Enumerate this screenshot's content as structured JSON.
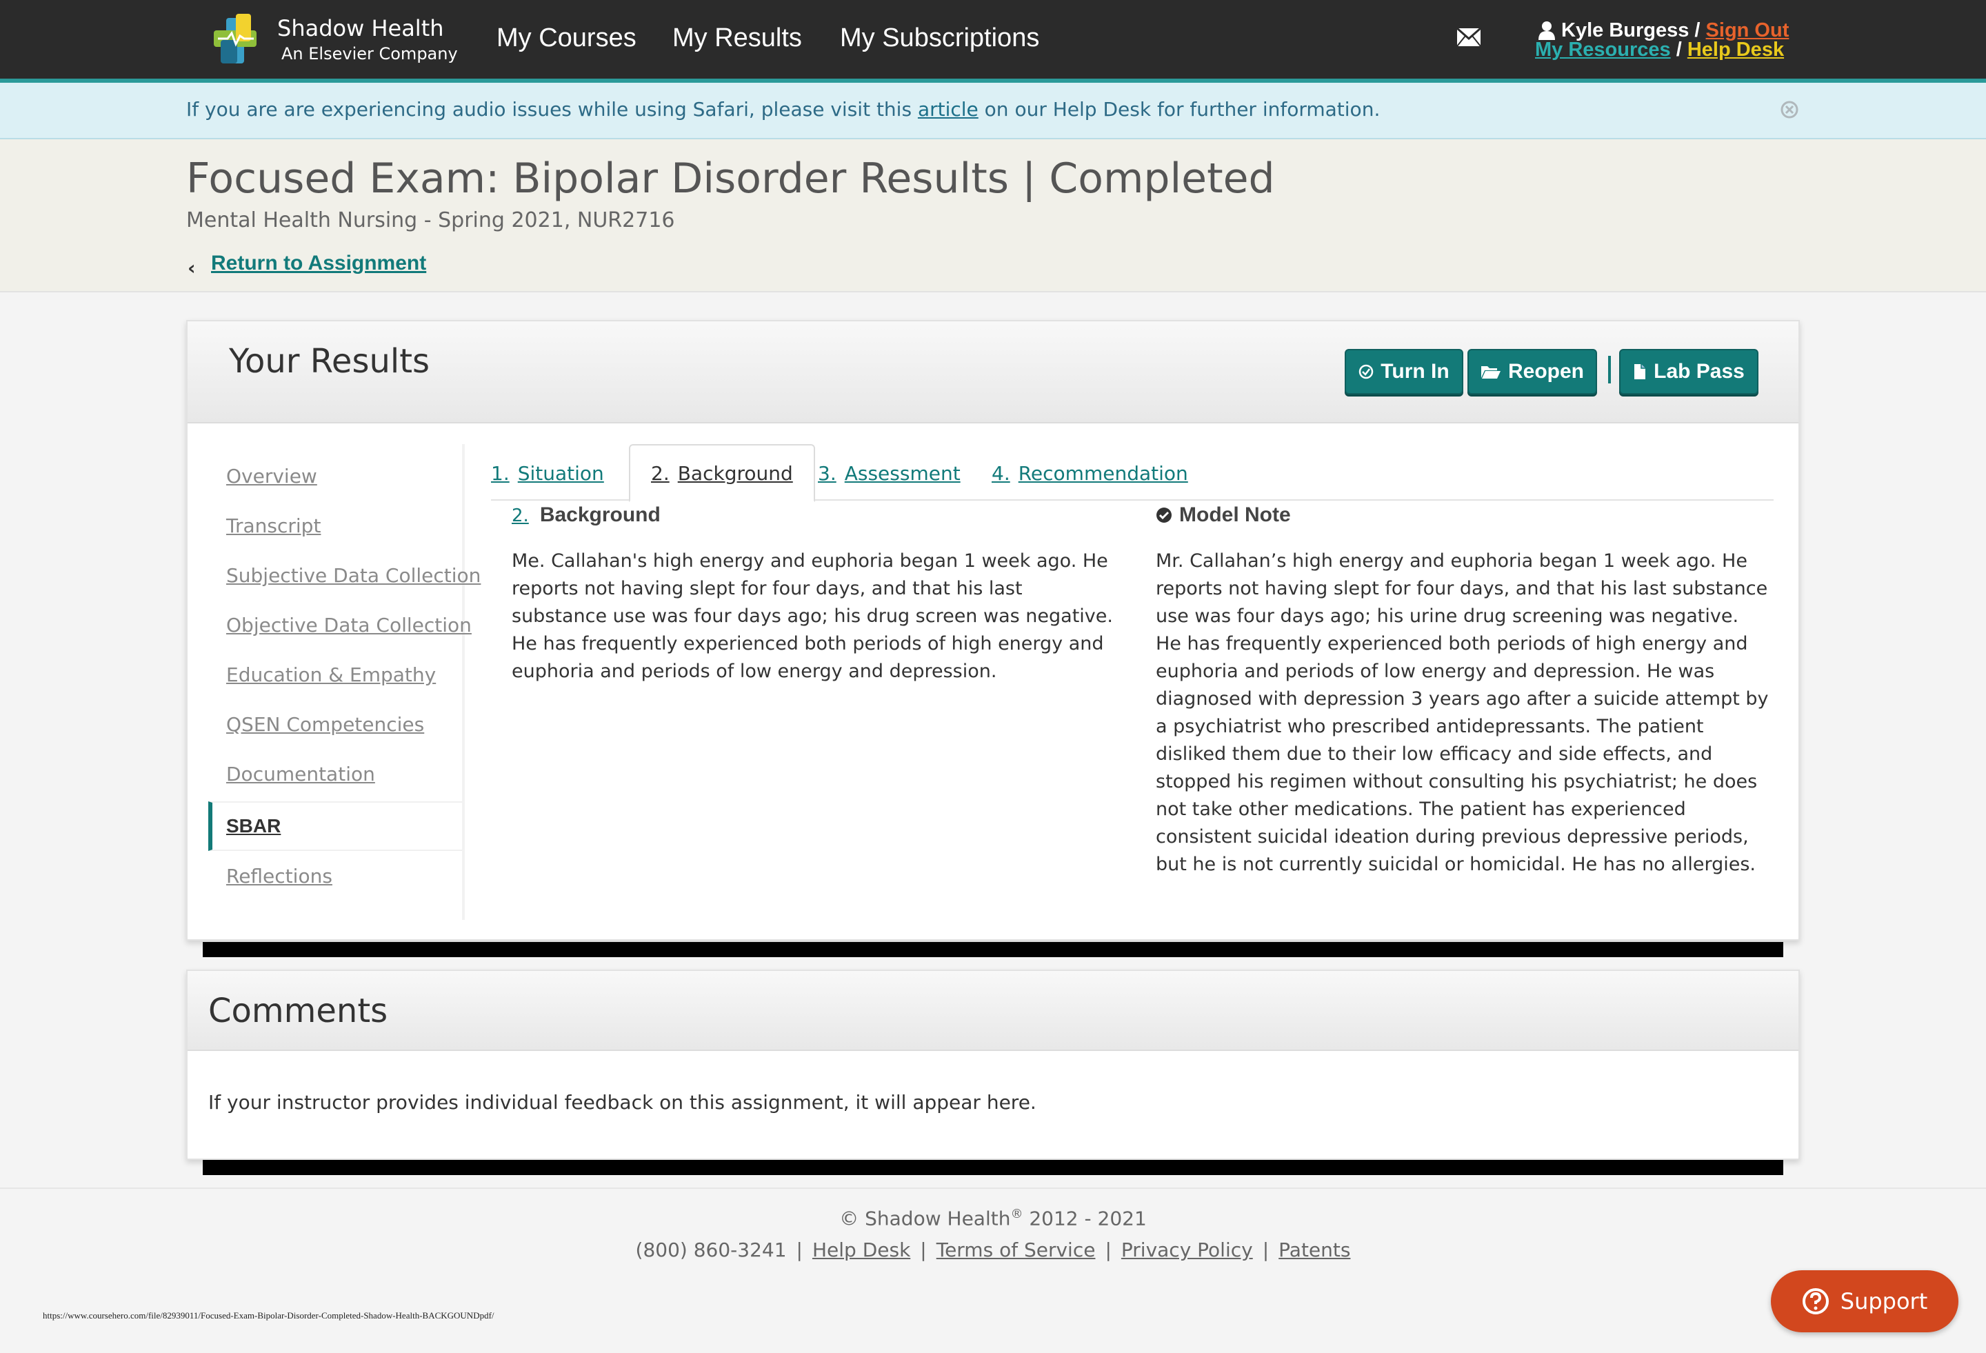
{
  "brand": {
    "name": "Shadow Health",
    "tagline": "An Elsevier Company"
  },
  "nav": {
    "items": [
      "My Courses",
      "My Results",
      "My Subscriptions"
    ]
  },
  "user": {
    "name": "Kyle Burgess",
    "sign_out": "Sign Out",
    "my_resources": "My Resources",
    "help_desk": "Help Desk",
    "sep1": "/",
    "sep2": "/"
  },
  "alert": {
    "before": "If you are are experiencing audio issues while using Safari, please visit this ",
    "link": "article",
    "after": " on our Help Desk for further information."
  },
  "page": {
    "title": "Focused Exam: Bipolar Disorder Results | Completed",
    "subtitle": "Mental Health Nursing - Spring 2021, NUR2716",
    "back_link": "Return to Assignment"
  },
  "results": {
    "title": "Your Results",
    "buttons": {
      "turn_in": "Turn In",
      "reopen": "Reopen",
      "lab_pass": "Lab Pass"
    },
    "sidebar": [
      {
        "label": "Overview"
      },
      {
        "label": "Transcript"
      },
      {
        "label": "Subjective Data Collection"
      },
      {
        "label": "Objective Data Collection"
      },
      {
        "label": "Education & Empathy"
      },
      {
        "label": "QSEN Competencies"
      },
      {
        "label": "Documentation"
      },
      {
        "label": "SBAR",
        "active": true
      },
      {
        "label": "Reflections"
      }
    ],
    "tabs": [
      {
        "num": "1.",
        "label": "Situation"
      },
      {
        "num": "2.",
        "label": "Background",
        "active": true
      },
      {
        "num": "3.",
        "label": "Assessment"
      },
      {
        "num": "4.",
        "label": "Recommendation"
      }
    ],
    "background": {
      "num": "2.",
      "heading": "Background",
      "text": "Me. Callahan's high energy and euphoria began 1 week ago. He reports not having slept for four days, and that his last substance use was four days ago; his drug screen was negative. He has frequently experienced both periods of high energy and euphoria and periods of low energy and depression."
    },
    "model_note": {
      "heading": "Model Note",
      "text": "Mr. Callahan’s high energy and euphoria began 1 week ago. He reports not having slept for four days, and that his last substance use was four days ago; his urine drug screening was negative. He has frequently experienced both periods of high energy and euphoria and periods of low energy and depression. He was diagnosed with depression 3 years ago after a suicide attempt by a psychiatrist who prescribed antidepressants. The patient disliked them due to their low efficacy and side effects, and stopped his regimen without consulting his psychiatrist; he does not take other medications. The patient has experienced consistent suicidal ideation during previous depressive periods, but he is not currently suicidal or homicidal. He has no allergies."
    }
  },
  "comments": {
    "title": "Comments",
    "text": "If your instructor provides individual feedback on this assignment, it will appear here."
  },
  "footer": {
    "copyright_symbol": "©",
    "copyright_name": "Shadow Health",
    "copyright_years": "2012 - 2021",
    "phone": "(800) 860-3241",
    "links": [
      "Help Desk",
      "Terms of Service",
      "Privacy Policy",
      "Patents"
    ],
    "source_url": "https://www.coursehero.com/file/82939011/Focused-Exam-Bipolar-Disorder-Completed-Shadow-Health-BACKGOUNDpdf/"
  },
  "support": {
    "label": "Support"
  },
  "colors": {
    "topbar": "#2b2b2b",
    "accent_teal": "#137a78",
    "alert_bg": "#dcf0f5",
    "sign_out": "#e8632c",
    "help_desk": "#e8c91c",
    "support_button": "#d2471e"
  }
}
